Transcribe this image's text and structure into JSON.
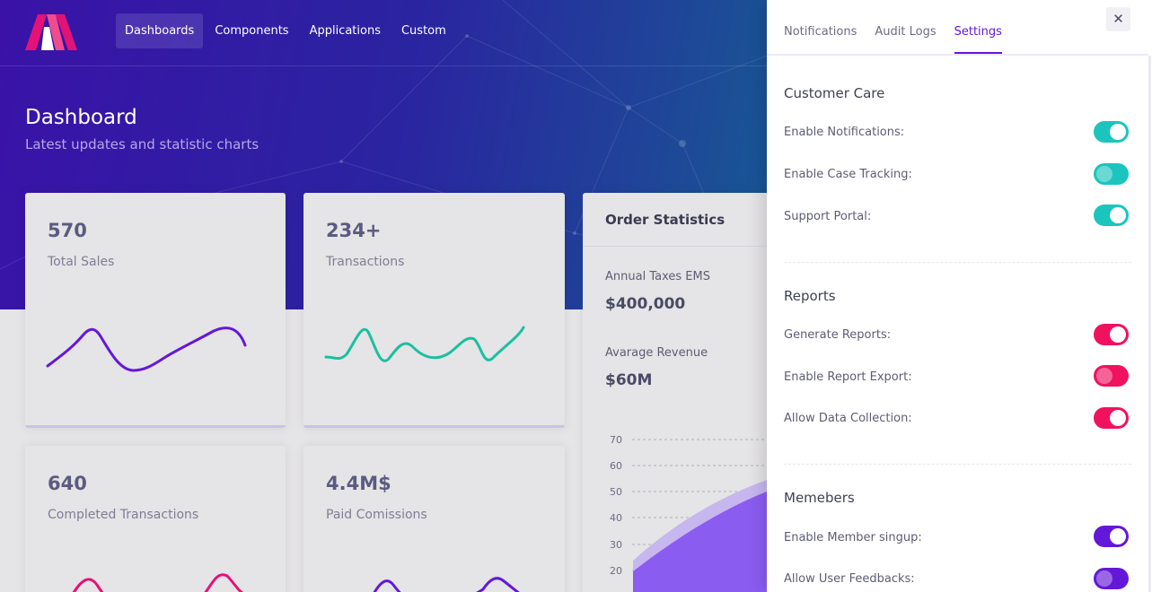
{
  "nav": {
    "items": [
      {
        "label": "Dashboards",
        "active": true
      },
      {
        "label": "Components",
        "active": false
      },
      {
        "label": "Applications",
        "active": false
      },
      {
        "label": "Custom",
        "active": false
      }
    ]
  },
  "page": {
    "title": "Dashboard",
    "subtitle": "Latest updates and statistic charts"
  },
  "stats": [
    {
      "value": "570",
      "label": "Total Sales",
      "color": "#6418d7"
    },
    {
      "value": "234+",
      "label": "Transactions",
      "color": "#1bbfa0"
    },
    {
      "value": "640",
      "label": "Completed Transactions",
      "color": "#e41277"
    },
    {
      "value": "4.4M$",
      "label": "Paid Comissions",
      "color": "#6418d7"
    }
  ],
  "order_statistics": {
    "title": "Order Statistics",
    "annual_taxes_label": "Annual Taxes EMS",
    "annual_taxes_value": "$400,000",
    "avg_revenue_label": "Avarage Revenue",
    "avg_revenue_value": "$60M",
    "y_ticks": [
      "70",
      "60",
      "50",
      "40",
      "30",
      "20"
    ]
  },
  "panel": {
    "tabs": [
      {
        "label": "Notifications",
        "active": false
      },
      {
        "label": "Audit Logs",
        "active": false
      },
      {
        "label": "Settings",
        "active": true
      }
    ],
    "close_icon": "close-icon",
    "sections": [
      {
        "title": "Customer Care",
        "color": "#1bc5bd",
        "rows": [
          {
            "label": "Enable Notifications:",
            "on": true
          },
          {
            "label": "Enable Case Tracking:",
            "on": false
          },
          {
            "label": "Support Portal:",
            "on": true
          }
        ]
      },
      {
        "title": "Reports",
        "color": "#f0125f",
        "rows": [
          {
            "label": "Generate Reports:",
            "on": true
          },
          {
            "label": "Enable Report Export:",
            "on": false
          },
          {
            "label": "Allow Data Collection:",
            "on": true
          }
        ]
      },
      {
        "title": "Memebers",
        "color": "#6418d7",
        "rows": [
          {
            "label": "Enable Member singup:",
            "on": true
          },
          {
            "label": "Allow User Feedbacks:",
            "on": false
          }
        ]
      }
    ]
  }
}
